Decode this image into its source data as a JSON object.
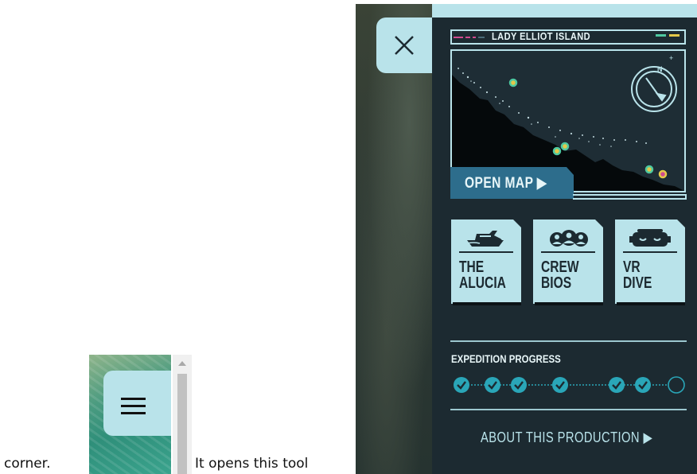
{
  "document": {
    "text_before": "corner.",
    "text_after": "It opens this tool"
  },
  "thumbnail": {
    "menu_icon": "hamburger-menu-icon"
  },
  "panel": {
    "close_icon": "close-icon",
    "map": {
      "title": "LADY ELLIOT ISLAND",
      "open_button_label": "OPEN MAP ▶",
      "compass_icon": "compass-icon",
      "accent_colors": {
        "pink": "#d04a8f",
        "green": "#4ec9a0",
        "yellow": "#e3c84a"
      }
    },
    "tiles": [
      {
        "line1": "THE",
        "line2": "ALUCIA",
        "icon": "ship-icon"
      },
      {
        "line1": "CREW",
        "line2": "BIOS",
        "icon": "crew-icon"
      },
      {
        "line1": "VR",
        "line2": "DIVE",
        "icon": "vr-headset-icon"
      }
    ],
    "progress": {
      "label": "EXPEDITION PROGRESS",
      "completed": 7,
      "total": 8
    },
    "about_label": "ABOUT THIS PRODUCTION ▶"
  },
  "colors": {
    "panel_bg": "#1c2a31",
    "accent": "#b9e3ea",
    "button_blue": "#2d6d8c",
    "check_teal": "#2aa6b8"
  }
}
